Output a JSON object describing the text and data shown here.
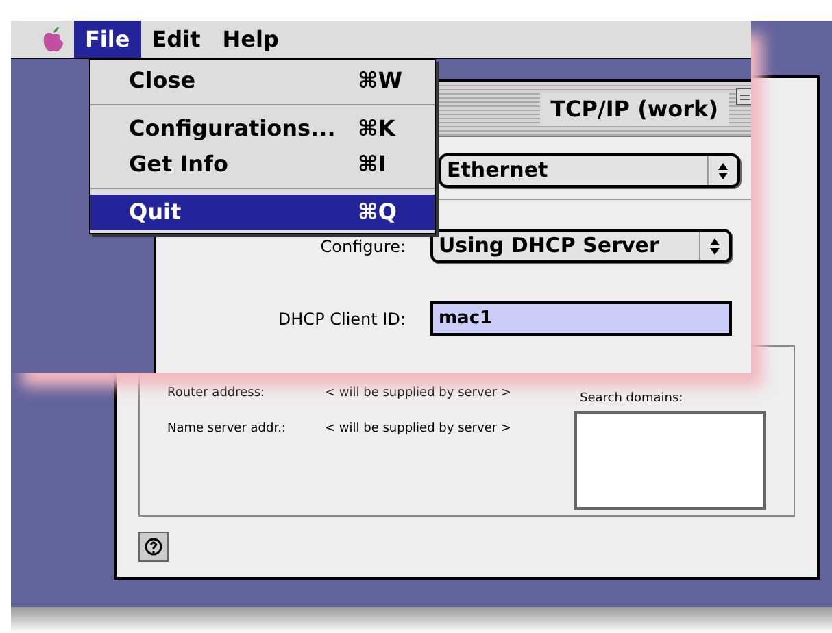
{
  "menu_bar": {
    "items": [
      {
        "label": "File",
        "selected": true
      },
      {
        "label": "Edit",
        "selected": false
      },
      {
        "label": "Help",
        "selected": false
      }
    ]
  },
  "file_menu": {
    "items": [
      {
        "kind": "item",
        "label": "Close",
        "shortcut": "⌘W",
        "selected": false
      },
      {
        "kind": "separator"
      },
      {
        "kind": "item",
        "label": "Configurations...",
        "shortcut": "⌘K",
        "selected": false
      },
      {
        "kind": "item",
        "label": "Get Info",
        "shortcut": "⌘I",
        "selected": false
      },
      {
        "kind": "separator"
      },
      {
        "kind": "item",
        "label": "Quit",
        "shortcut": "⌘Q",
        "selected": true
      }
    ]
  },
  "window": {
    "title": "TCP/IP (work)"
  },
  "popup_1": {
    "value": "Ethernet"
  },
  "configure": {
    "label": "Configure:",
    "value": "Using DHCP Server"
  },
  "dhcp_client_id": {
    "label": "DHCP Client ID:",
    "value": "mac1",
    "text_selected": true
  },
  "background_window": {
    "rows": [
      {
        "label": "Router address:",
        "value": "< will be supplied by server >"
      },
      {
        "label": "Name server addr.:",
        "value": "< will be supplied by server >"
      }
    ],
    "search_domains": {
      "label": "Search domains:"
    }
  }
}
